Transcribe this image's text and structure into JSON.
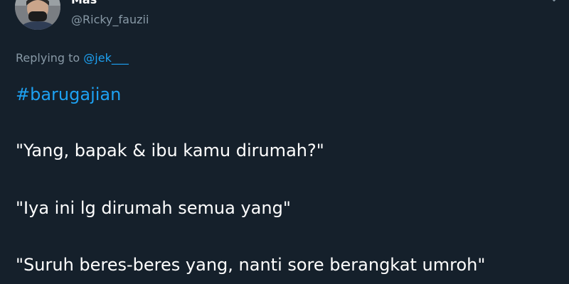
{
  "author": {
    "display_name": "Mas",
    "handle": "@Ricky_fauzii"
  },
  "reply": {
    "prefix": "Replying to ",
    "mention": "@jek___"
  },
  "tweet": {
    "hashtag": "#barugajian",
    "lines": [
      "\"Yang, bapak & ibu kamu dirumah?\"",
      "\"Iya ini lg dirumah semua yang\"",
      "\"Suruh beres-beres yang, nanti sore berangkat umroh\""
    ]
  },
  "icons": {
    "avatar": "avatar",
    "more": "chevron-down-icon"
  },
  "colors": {
    "background": "#15202b",
    "text": "#ffffff",
    "secondary_text": "#8899a6",
    "link": "#1da1f2"
  }
}
